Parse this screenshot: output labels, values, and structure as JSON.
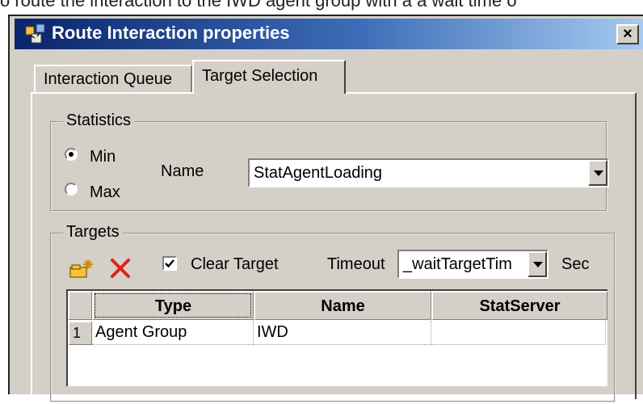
{
  "caption": "o route the interaction to the IWD agent group with a a wait time o",
  "window": {
    "title": "Route Interaction properties",
    "close_label": "×"
  },
  "tabs": [
    {
      "label": "Interaction Queue",
      "active": false
    },
    {
      "label": "Target Selection",
      "active": true
    }
  ],
  "statistics": {
    "legend": "Statistics",
    "options": [
      {
        "label": "Min",
        "selected": true
      },
      {
        "label": "Max",
        "selected": false
      }
    ],
    "name_label": "Name",
    "name_value": "StatAgentLoading"
  },
  "targets": {
    "legend": "Targets",
    "clear_target_label": "Clear Target",
    "clear_target_checked": true,
    "timeout_label": "Timeout",
    "timeout_value": "_waitTargetTim",
    "timeout_unit": "Sec",
    "columns": [
      "Type",
      "Name",
      "StatServer"
    ],
    "rows": [
      {
        "index": "1",
        "type": "Agent Group",
        "name": "IWD",
        "statserver": ""
      }
    ]
  },
  "icons": {
    "app": "route-interaction-icon",
    "add_target": "add-target-icon",
    "delete_target": "delete-x-icon"
  },
  "colors": {
    "titlebar_start": "#0a246a",
    "titlebar_end": "#a6caf0",
    "delete_icon": "#e0201b",
    "dialog_face": "#d4d0c8"
  }
}
